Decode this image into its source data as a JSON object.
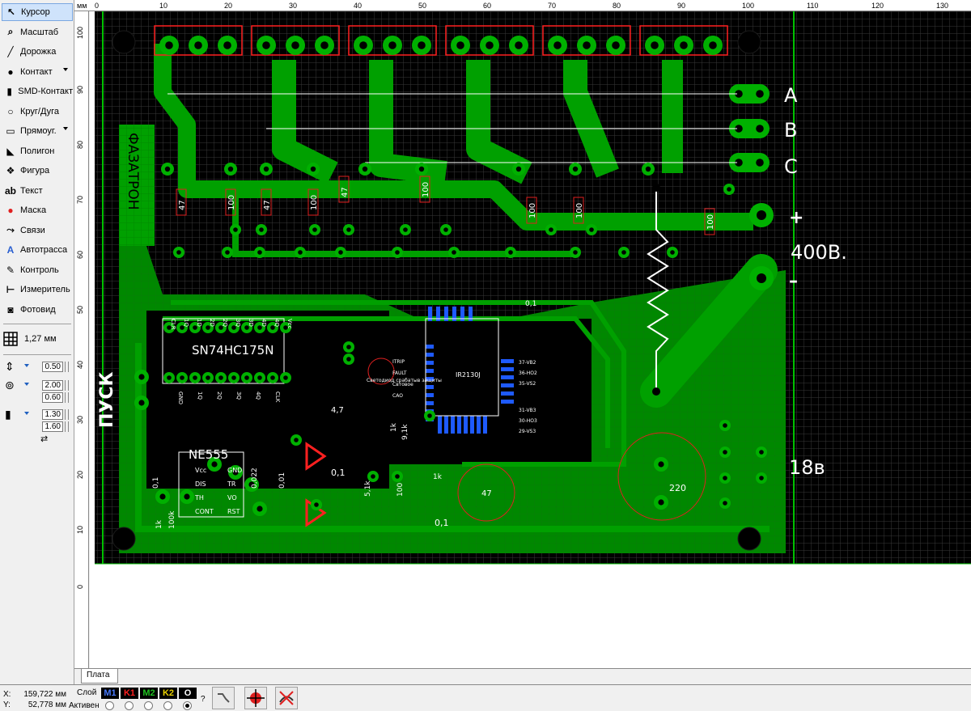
{
  "toolbar": {
    "items": [
      {
        "label": "Курсор",
        "icon": "cursor-icon",
        "active": true,
        "menu": false
      },
      {
        "label": "Масштаб",
        "icon": "zoom-icon",
        "active": false,
        "menu": false
      },
      {
        "label": "Дорожка",
        "icon": "track-icon",
        "active": false,
        "menu": false
      },
      {
        "label": "Контакт",
        "icon": "pad-icon",
        "active": false,
        "menu": true
      },
      {
        "label": "SMD-Контакт",
        "icon": "smd-pad-icon",
        "active": false,
        "menu": false
      },
      {
        "label": "Круг/Дуга",
        "icon": "circle-arc-icon",
        "active": false,
        "menu": false
      },
      {
        "label": "Прямоуг.",
        "icon": "rectangle-icon",
        "active": false,
        "menu": true
      },
      {
        "label": "Полигон",
        "icon": "polygon-icon",
        "active": false,
        "menu": false
      },
      {
        "label": "Фигура",
        "icon": "shape-icon",
        "active": false,
        "menu": false
      },
      {
        "label": "Текст",
        "icon": "text-icon",
        "active": false,
        "menu": false
      },
      {
        "label": "Маска",
        "icon": "mask-icon",
        "active": false,
        "menu": false
      },
      {
        "label": "Связи",
        "icon": "connections-icon",
        "active": false,
        "menu": false
      },
      {
        "label": "Автотрасса",
        "icon": "autoroute-icon",
        "active": false,
        "menu": false
      },
      {
        "label": "Контроль",
        "icon": "check-icon",
        "active": false,
        "menu": false
      },
      {
        "label": "Измеритель",
        "icon": "ruler-icon",
        "active": false,
        "menu": false
      },
      {
        "label": "Фотовид",
        "icon": "camera-icon",
        "active": false,
        "menu": false
      }
    ],
    "grid_size": "1,27 мм",
    "track_width": "0.50",
    "pad_outer": "2.00",
    "pad_inner": "0.60",
    "smd_width": "1.30",
    "smd_height": "1.60"
  },
  "ruler": {
    "unit": "мм",
    "top_ticks": [
      "0",
      "10",
      "20",
      "30",
      "40",
      "50",
      "60",
      "70",
      "80",
      "90",
      "100",
      "110",
      "120",
      "130"
    ],
    "left_ticks": [
      "100",
      "90",
      "80",
      "70",
      "60",
      "50",
      "40",
      "30",
      "20",
      "10",
      "0"
    ]
  },
  "board": {
    "logo_text": "ФАЗАТРОН",
    "start_label": "ПУСК",
    "phase_labels": [
      "A",
      "B",
      "C"
    ],
    "plus_label": "+",
    "voltage_label": "400В.",
    "minus_label": "–",
    "supply_label": "18в",
    "chip1": "SN74HC175N",
    "chip2": "NE555",
    "driver": "IR2130J",
    "resistor_values": [
      "47",
      "100",
      "47",
      "100",
      "47",
      "100",
      "100",
      "100",
      "100"
    ],
    "cap_values": [
      "0,1",
      "0,022",
      "0,01",
      "0,1",
      "0,1",
      "0,1"
    ],
    "misc_values": [
      "4,7",
      "1k",
      "9,1k",
      "5,1k",
      "100",
      "1k",
      "47",
      "220",
      "100k",
      "1k"
    ],
    "chip1_top_pins": [
      "CLR",
      "1Q",
      "1D",
      "2D",
      "2Q",
      "3Q",
      "3D",
      "4D",
      "4Q",
      "Vcc"
    ],
    "chip1_bottom_pins": [
      "GND",
      "1Q",
      "2Q",
      "3Q",
      "4Q",
      "CLK"
    ],
    "ne555_pins_left": [
      "Vcc",
      "DIS",
      "TH",
      "CONT"
    ],
    "ne555_pins_right": [
      "GND",
      "TR",
      "VO",
      "RST"
    ],
    "driver_pins_left": [
      "ITRIP",
      "FAULT",
      "Свтовое",
      "CAO"
    ],
    "driver_pins_right": [
      "37-VB2",
      "36-HO2",
      "35-VS2",
      "31-VB3",
      "30-HO3",
      "29-VS3"
    ],
    "indicator_text": "Светодиод срабатыв защиты"
  },
  "tabs": {
    "active": "Плата"
  },
  "status": {
    "x_label": "X:",
    "x_value": "159,722 мм",
    "y_label": "Y:",
    "y_value": "52,778 мм",
    "layer_label": "Слой",
    "active_label": "Активен",
    "layers": [
      {
        "name": "M1",
        "color": "#4a7cff"
      },
      {
        "name": "K1",
        "color": "#ff2020"
      },
      {
        "name": "M2",
        "color": "#20c020"
      },
      {
        "name": "K2",
        "color": "#e8d000"
      },
      {
        "name": "O",
        "color": "#ffffff"
      }
    ],
    "active_layer": "O",
    "help_mark": "?"
  },
  "colors": {
    "copper": "#00a000",
    "board": "#000000",
    "grid": "#2a2a2a",
    "silk": "#ffffff",
    "smd": "#1e5aff",
    "outline": "#ff2020"
  }
}
